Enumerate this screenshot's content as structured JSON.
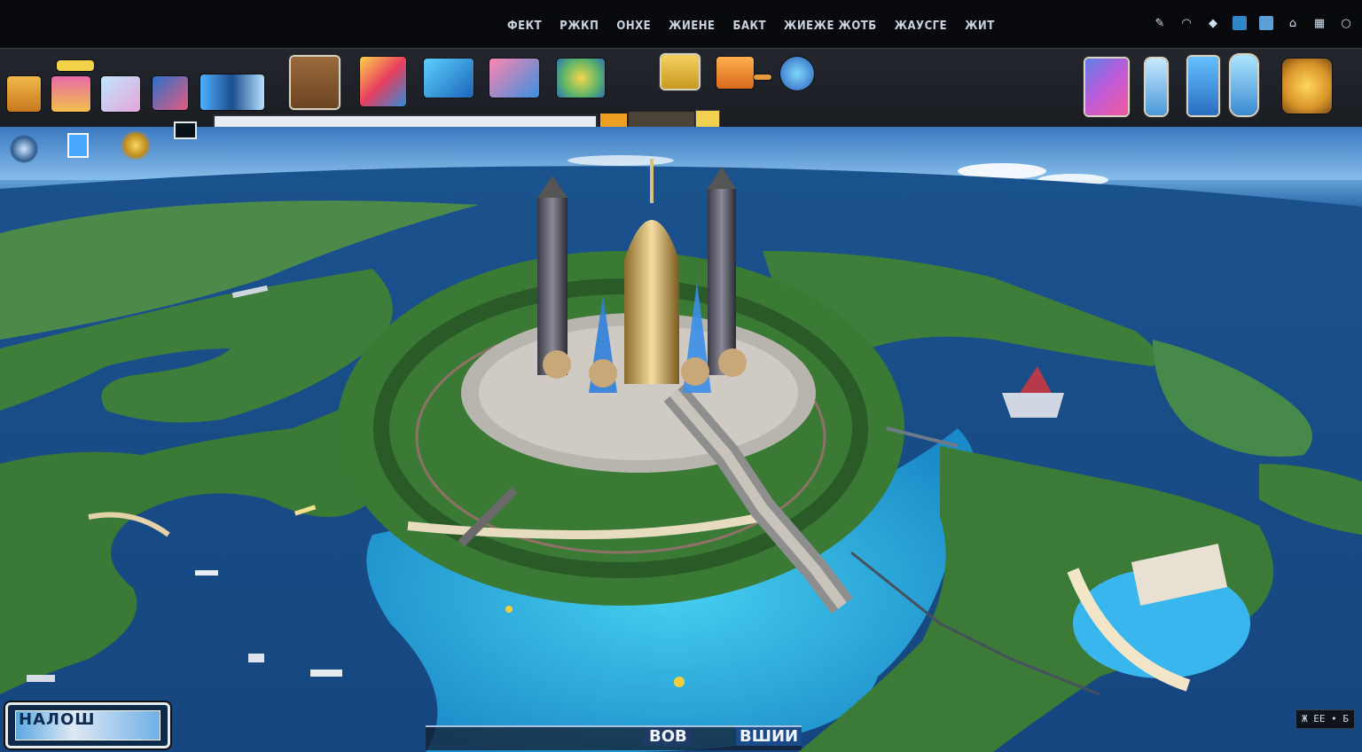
{
  "menu": {
    "items": [
      "ФЕКТ",
      "РЖКП",
      "ОНХЕ",
      "ЖИЕНЕ",
      "БАКТ",
      "ЖИЕЖЕ ЖОТБ",
      "ЖАУСГЕ",
      "ЖИТ"
    ]
  },
  "system_icons": [
    "pen-icon",
    "wifi-icon",
    "shield-icon",
    "window-icon",
    "screen-icon",
    "lock-icon",
    "grid-icon",
    "power-icon"
  ],
  "toolbar": {
    "left_tools": [
      "folder-tool",
      "calendar-tool",
      "gallery-tool",
      "paint-tool",
      "share-tool"
    ],
    "center_tools": [
      "block-tool",
      "flower-tool",
      "building-tool",
      "fountain-tool",
      "tree-tool"
    ],
    "mid_tools": [
      "plaza-tool",
      "bridge-tool",
      "vehicle-tool"
    ],
    "right_tools": [
      "portal-tool",
      "tower-tool",
      "pier-tool",
      "statue-tool",
      "gear-tool"
    ],
    "search_placeholder": ""
  },
  "hud_left": [
    "ship-marker",
    "info-card",
    "crystal-marker",
    "screen-toggle"
  ],
  "scene": {
    "description_tag": "island-city",
    "accent": "#2fa8e8",
    "land": "#3f7d3a",
    "deep_water": "#123f78",
    "shallow_water": "#29b6e0"
  },
  "minimap": {
    "label": "НАЛОШ"
  },
  "bottom": {
    "label_a": "ВОВ",
    "label_b": "ВШИИ"
  },
  "status": {
    "text": "Ж ЕЕ • Б"
  }
}
